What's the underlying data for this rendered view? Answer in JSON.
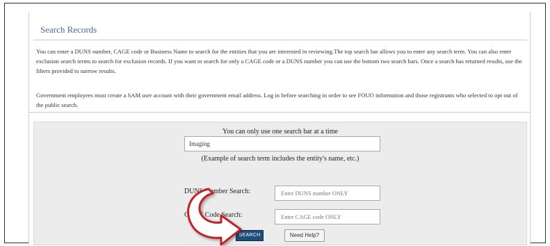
{
  "panel": {
    "title": "Search Records",
    "intro": "You can enter a DUNS number, CAGE code or Business Name to search for the entities that you are interested in reviewing.The top search bar allows you to enter any search term. You can also enter exclusion search terms to search for exclusion records. If you want to search for only a CAGE code or a DUNS number you can use the bottom two search bars. Once a search has returned results, use the filters provided to narrow results.",
    "notice": "Government employees must create a SAM user account with their government email address. Log in before searching in order to see FOUO information and those registrants who selected to opt out of the public search."
  },
  "search": {
    "hint": "You can only use one search bar at a time",
    "main_value": "Imaging",
    "example": "(Example of search term includes the entity's name, etc.)",
    "duns_label": "DUNS Number Search:",
    "duns_placeholder": "Enter DUNS number ONLY",
    "cage_label": "CAGE Code Search:",
    "cage_placeholder": "Enter CAGE code ONLY",
    "search_button": "SEARCH",
    "help_button": "Need Help?"
  },
  "colors": {
    "title": "#4a6b99",
    "search_button_bg": "#1f4e7a",
    "arrow_fill": "#ffffff",
    "arrow_outline": "#c0202a"
  },
  "icons": {
    "annotation": "curved-arrow-icon"
  }
}
